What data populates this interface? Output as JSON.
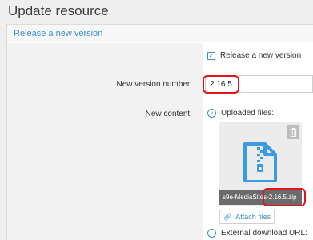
{
  "page": {
    "title": "Update resource"
  },
  "panel": {
    "header": "Release a new version"
  },
  "form": {
    "release_checkbox_label": "Release a new version",
    "version_label": "New version number:",
    "version_value": "2.16.5",
    "content_label": "New content:",
    "uploaded_label": "Uploaded files:",
    "file_name": "s9e-MediaSites-2.16.5.zip",
    "attach_label": "Attach files",
    "external_label": "External download URL:"
  },
  "icons": {
    "checkbox": "check-icon",
    "radio": "radio-check-icon",
    "trash": "trash-icon",
    "file": "zip-file-icon",
    "attach": "paperclip-icon"
  },
  "colors": {
    "accent": "#3b8fcf",
    "highlight": "#e0141a",
    "file_icon": "#3b9be0"
  }
}
